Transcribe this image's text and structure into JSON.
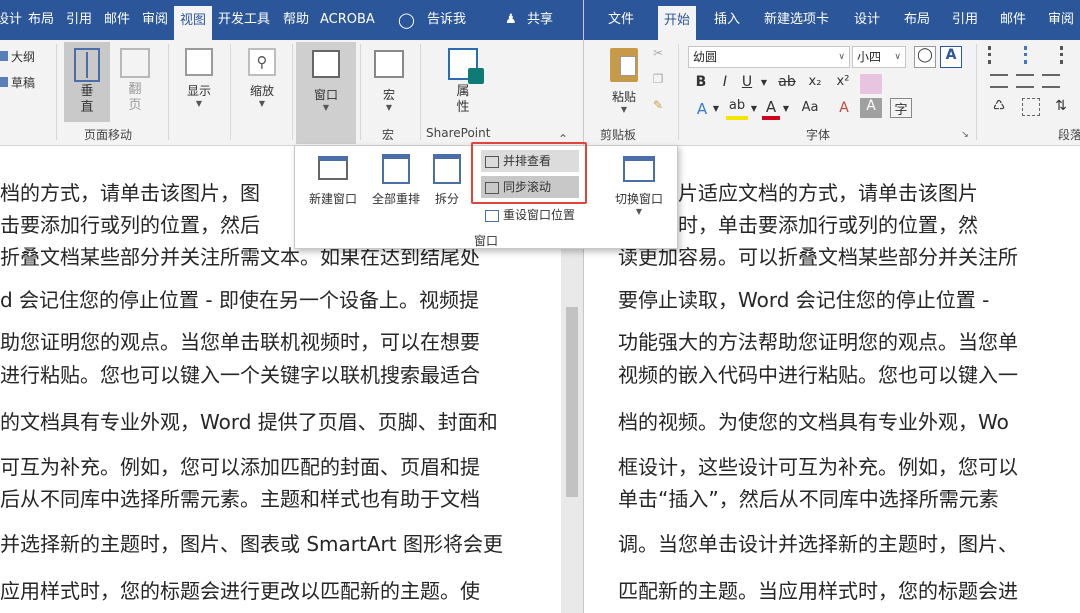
{
  "left_window": {
    "tabs": [
      "设计",
      "布局",
      "引用",
      "邮件",
      "审阅",
      "视图",
      "开发工具",
      "帮助",
      "ACROBA",
      "告诉我",
      "共享"
    ],
    "active_tab": "视图",
    "ribbon": {
      "outline": "大纲",
      "draft": "草稿",
      "vertical": "垂\n直",
      "page_flip": "翻\n页",
      "page_move_group": "页面移动",
      "show": "显示",
      "zoom": "缩放",
      "window": "窗口",
      "macro": "宏",
      "macro_group": "宏",
      "properties": "属\n性",
      "sharepoint_group": "SharePoint"
    },
    "popup": {
      "new_window": "新建窗口",
      "arrange_all": "全部重排",
      "split": "拆分",
      "view_side_by_side": "并排查看",
      "sync_scroll": "同步滚动",
      "reset_position": "重设窗口位置",
      "switch_window": "切换窗口",
      "group_label": "窗口"
    },
    "lines": [
      "档的方式，请单击该图片，图",
      "击要添加行或列的位置，然后",
      "折叠文档某些部分并关注所需文本。如果在达到结尾处",
      "d 会记住您的停止位置 - 即使在另一个设备上。视频提",
      "助您证明您的观点。当您单击联机视频时，可以在想要",
      "进行粘贴。您也可以键入一个关键字以联机搜索最适合",
      "的文档具有专业外观，Word 提供了页眉、页脚、封面和",
      "可互为补充。例如，您可以添加匹配的封面、页眉和提",
      "后从不同库中选择所需元素。主题和样式也有助于文档",
      "并选择新的主题时，图片、图表或 SmartArt 图形将会更",
      "应用样式时，您的标题会进行更改以匹配新的主题。使"
    ]
  },
  "right_window": {
    "tabs": [
      "文件",
      "开始",
      "插入",
      "新建选项卡",
      "设计",
      "布局",
      "引用",
      "邮件",
      "审阅"
    ],
    "active_tab": "开始",
    "ribbon": {
      "paste": "粘贴",
      "clipboard_group": "剪贴板",
      "font_name": "幼圆",
      "font_size": "小四",
      "font_group": "字体",
      "para_group": "段落"
    },
    "lines": [
      "更改图片适应文档的方式，请单击该图片",
      "理表格时，单击要添加行或列的位置，然",
      "读更加容易。可以折叠文档某些部分并关注所",
      "要停止读取，Word 会记住您的停止位置 -",
      "功能强大的方法帮助您证明您的观点。当您单",
      "视频的嵌入代码中进行粘贴。您也可以键入一",
      "档的视频。为使您的文档具有专业外观，Wo",
      "框设计，这些设计可互为补充。例如，您可以",
      "单击“插入”，然后从不同库中选择所需元素",
      "调。当您单击设计并选择新的主题时，图片、",
      "匹配新的主题。当应用样式时，您的标题会进"
    ]
  },
  "colors": {
    "title_bar": "#2b579a",
    "ribbon_bg": "#f3f3f3",
    "highlight_border": "#e0443c",
    "text": "#262626"
  }
}
